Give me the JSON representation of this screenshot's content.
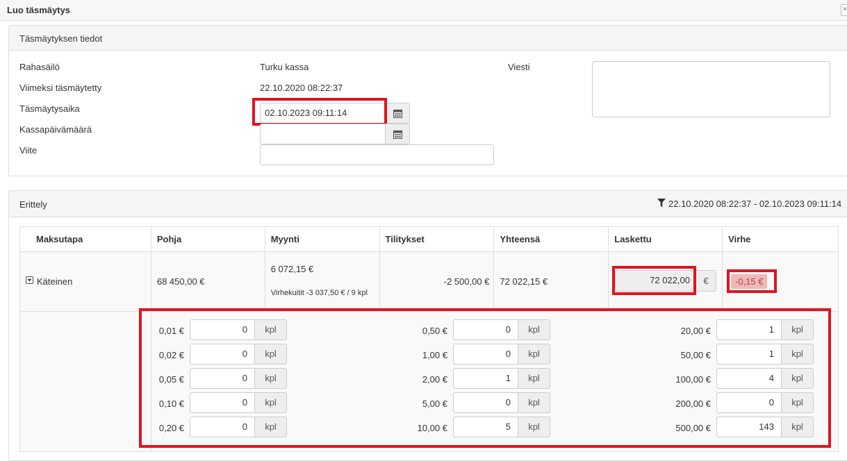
{
  "window": {
    "title": "Luo täsmäytys",
    "close_label": "×"
  },
  "info_panel": {
    "title": "Täsmäytyksen tiedot",
    "fields": {
      "rahasailo_label": "Rahasäilö",
      "rahasailo_value": "Turku kassa",
      "viimeksi_label": "Viimeksi täsmäytetty",
      "viimeksi_value": "22.10.2020 08:22:37",
      "tasmaytysaika_label": "Täsmäytysaika",
      "tasmaytysaika_value": "02.10.2023 09:11:14",
      "kassapaiva_label": "Kassapäivämäärä",
      "kassapaiva_value": "",
      "viite_label": "Viite",
      "viite_value": "",
      "viesti_label": "Viesti",
      "viesti_value": ""
    }
  },
  "erittely_panel": {
    "title": "Erittely",
    "filter_range": "22.10.2020 08:22:37 - 02.10.2023 09:11:14",
    "columns": [
      "Maksutapa",
      "Pohja",
      "Myynti",
      "Tilitykset",
      "Yhteensä",
      "Laskettu",
      "Virhe"
    ],
    "row": {
      "maksutapa": "Käteinen",
      "pohja": "68 450,00 €",
      "myynti": "6 072,15 €",
      "myynti_note": "Virhekuitit -3 037,50 € / 9 kpl",
      "tilitykset": "-2 500,00 €",
      "yhteensa": "72 022,15 €",
      "laskettu": "72 022,00",
      "laskettu_unit": "€",
      "virhe": "-0,15 €"
    },
    "unit": "kpl",
    "denominations": [
      [
        {
          "label": "0,01 €",
          "count": "0"
        },
        {
          "label": "0,02 €",
          "count": "0"
        },
        {
          "label": "0,05 €",
          "count": "0"
        },
        {
          "label": "0,10 €",
          "count": "0"
        },
        {
          "label": "0,20 €",
          "count": "0"
        }
      ],
      [
        {
          "label": "0,50 €",
          "count": "0"
        },
        {
          "label": "1,00 €",
          "count": "0"
        },
        {
          "label": "2,00 €",
          "count": "1"
        },
        {
          "label": "5,00 €",
          "count": "0"
        },
        {
          "label": "10,00 €",
          "count": "5"
        }
      ],
      [
        {
          "label": "20,00 €",
          "count": "1"
        },
        {
          "label": "50,00 €",
          "count": "1"
        },
        {
          "label": "100,00 €",
          "count": "4"
        },
        {
          "label": "200,00 €",
          "count": "0"
        },
        {
          "label": "500,00 €",
          "count": "143"
        }
      ]
    ]
  },
  "colors": {
    "highlight": "#e0141e",
    "error_bg": "#f2b8b8",
    "error_text": "#a94442"
  }
}
